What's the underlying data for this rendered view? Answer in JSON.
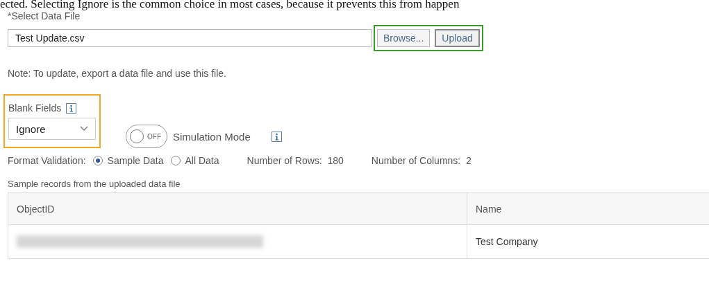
{
  "caption_fragment": "ected. Selecting Ignore is the common choice in most cases, because it prevents this from happen",
  "file": {
    "label": "*Select Data File",
    "value": "Test Update.csv"
  },
  "buttons": [
    "Browse...",
    "Upload"
  ],
  "note": "Note: To update, export a data file and use this file.",
  "blank_fields": {
    "label": "Blank Fields",
    "value": "Ignore"
  },
  "simulation": {
    "on": false,
    "state_text": "OFF",
    "label": "Simulation Mode"
  },
  "format_validation": {
    "label": "Format Validation:",
    "options": [
      {
        "label": "Sample Data",
        "selected": true
      },
      {
        "label": "All Data",
        "selected": false
      }
    ]
  },
  "stats": [
    {
      "label": "Number of Rows:",
      "value": "180"
    },
    {
      "label": "Number of Columns:",
      "value": "2"
    }
  ],
  "table": {
    "caption": "Sample records from the uploaded data file",
    "columns": [
      "ObjectID",
      "Name"
    ],
    "rows": [
      {
        "cells": [
          {
            "redacted": true
          },
          {
            "text": "Test Company"
          }
        ]
      }
    ]
  }
}
